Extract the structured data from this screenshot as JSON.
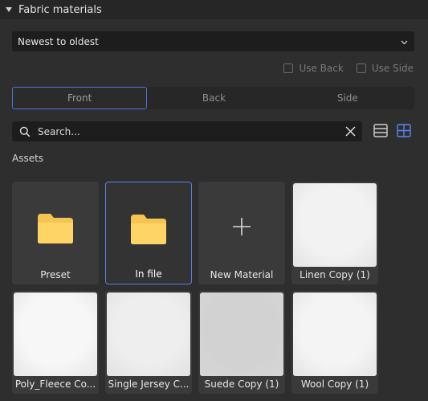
{
  "panel": {
    "title": "Fabric materials"
  },
  "sort": {
    "selected": "Newest to oldest"
  },
  "options": {
    "use_back": "Use Back",
    "use_side": "Use Side"
  },
  "side_tabs": [
    "Front",
    "Back",
    "Side"
  ],
  "search": {
    "placeholder": "Search..."
  },
  "assets": {
    "title": "Assets",
    "items": [
      {
        "label": "Preset",
        "kind": "folder"
      },
      {
        "label": "In file",
        "kind": "folder",
        "selected": true
      },
      {
        "label": "New Material",
        "kind": "add"
      },
      {
        "label": "Linen Copy (1)",
        "kind": "material",
        "color": "#f2f2f2"
      },
      {
        "label": "Poly_Fleece Co...",
        "kind": "material",
        "color": "#f7f7f7"
      },
      {
        "label": "Single Jersey C...",
        "kind": "material",
        "color": "#eeeeee"
      },
      {
        "label": "Suede Copy (1)",
        "kind": "material",
        "color": "#d2d2d2"
      },
      {
        "label": "Wool Copy (1)",
        "kind": "material",
        "color": "#f4f4f4"
      }
    ]
  },
  "colors": {
    "accent": "#4a76d4",
    "folder": "#f5c451"
  }
}
